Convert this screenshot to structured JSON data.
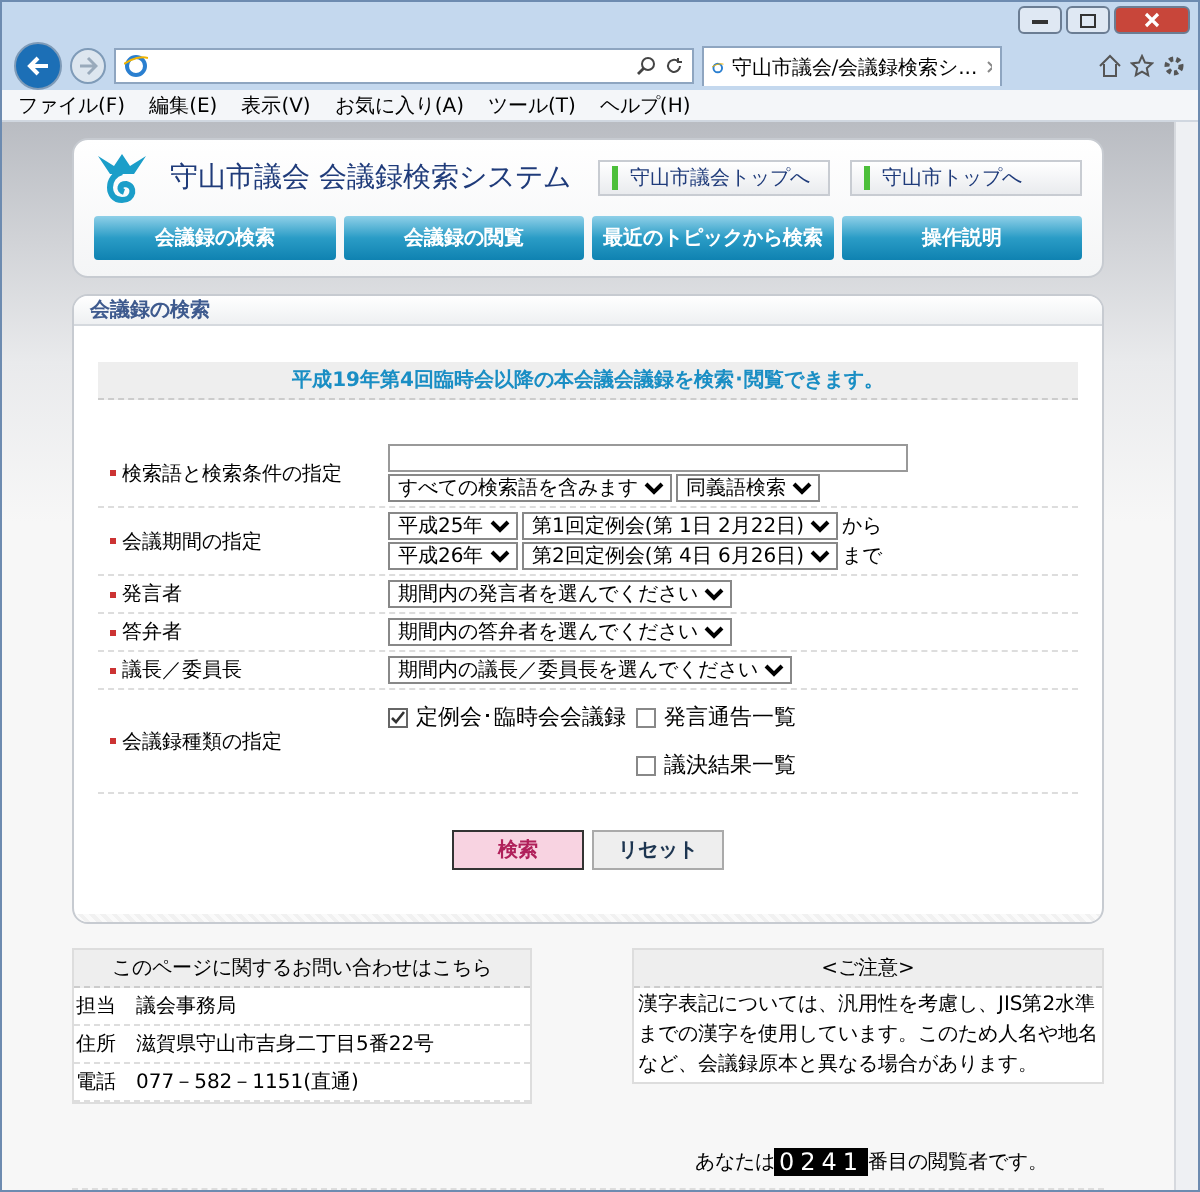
{
  "browser": {
    "tab_title": "守山市議会/会議録検索シ...",
    "menu": [
      "ファイル(F)",
      "編集(E)",
      "表示(V)",
      "お気に入り(A)",
      "ツール(T)",
      "ヘルプ(H)"
    ]
  },
  "header": {
    "title": "守山市議会  会議録検索システム",
    "links": [
      "守山市議会トップへ",
      "守山市トップへ"
    ],
    "nav": [
      "会議録の検索",
      "会議録の閲覧",
      "最近のトピックから検索",
      "操作説明"
    ]
  },
  "search_panel": {
    "heading": "会議録の検索",
    "notice": "平成19年第4回臨時会以降の本会議会議録を検索･閲覧できます。",
    "rows": [
      {
        "label": "検索語と検索条件の指定",
        "lines": [
          [
            {
              "kind": "input"
            }
          ],
          [
            {
              "kind": "select",
              "value": "すべての検索語を含みます"
            },
            {
              "kind": "select",
              "value": "同義語検索"
            }
          ]
        ]
      },
      {
        "label": "会議期間の指定",
        "lines": [
          [
            {
              "kind": "select",
              "value": "平成25年"
            },
            {
              "kind": "select",
              "value": "第1回定例会(第 1日 2月22日)"
            },
            {
              "kind": "text",
              "value": "から"
            }
          ],
          [
            {
              "kind": "select",
              "value": "平成26年"
            },
            {
              "kind": "select",
              "value": "第2回定例会(第 4日 6月26日)"
            },
            {
              "kind": "text",
              "value": "まで"
            }
          ]
        ]
      },
      {
        "label": "発言者",
        "lines": [
          [
            {
              "kind": "select",
              "value": "期間内の発言者を選んでください"
            }
          ]
        ]
      },
      {
        "label": "答弁者",
        "lines": [
          [
            {
              "kind": "select",
              "value": "期間内の答弁者を選んでください"
            }
          ]
        ]
      },
      {
        "label": "議長／委員長",
        "lines": [
          [
            {
              "kind": "select",
              "value": "期間内の議長／委員長を選んでください"
            }
          ]
        ]
      },
      {
        "label": "会議録種類の指定",
        "lines": [
          [
            {
              "kind": "checkbox",
              "value": "定例会･臨時会会議録",
              "checked": true
            },
            {
              "kind": "checkbox",
              "value": "発言通告一覧",
              "checked": false
            }
          ],
          [
            {
              "kind": "spacer"
            },
            {
              "kind": "checkbox",
              "value": "議決結果一覧",
              "checked": false
            }
          ]
        ]
      }
    ],
    "buttons": [
      {
        "label": "検索",
        "kind": "primary"
      },
      {
        "label": "リセット",
        "kind": "secondary"
      }
    ]
  },
  "contact": {
    "heading": "このページに関するお問い合わせはこちら",
    "rows": [
      {
        "key": "担当",
        "value": "議会事務局"
      },
      {
        "key": "住所",
        "value": "滋賀県守山市吉身二丁目5番22号"
      },
      {
        "key": "電話",
        "value": "077－582－1151(直通)"
      }
    ]
  },
  "caution": {
    "heading": "<ご注意>",
    "text": "漢字表記については、汎用性を考慮し、JIS第2水準までの漢字を使用しています。このため人名や地名など、会議録原本と異なる場合があります。"
  },
  "counter": {
    "prefix": "あなたは",
    "digits": "0241",
    "suffix": "番目の閲覧者です。"
  }
}
